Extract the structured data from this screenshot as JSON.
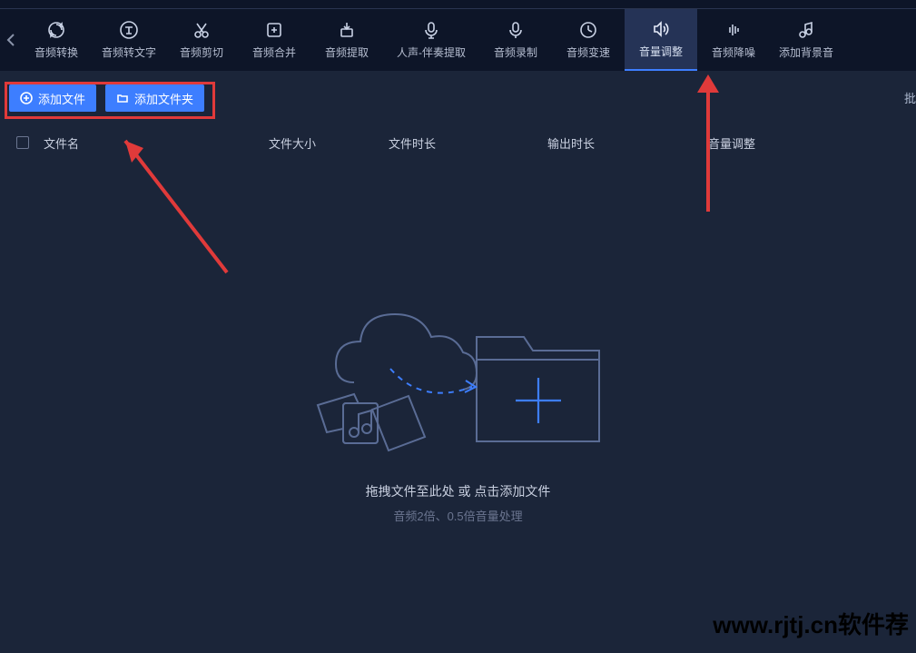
{
  "toolbar": {
    "items": [
      {
        "label": "音频转换",
        "icon": "refresh"
      },
      {
        "label": "音频转文字",
        "icon": "text"
      },
      {
        "label": "音频剪切",
        "icon": "scissors"
      },
      {
        "label": "音频合并",
        "icon": "merge"
      },
      {
        "label": "音频提取",
        "icon": "extract"
      },
      {
        "label": "人声-伴奏提取",
        "icon": "mic",
        "wide": true
      },
      {
        "label": "音频录制",
        "icon": "record"
      },
      {
        "label": "音频变速",
        "icon": "speed"
      },
      {
        "label": "音量调整",
        "icon": "volume",
        "active": true
      },
      {
        "label": "音频降噪",
        "icon": "denoise"
      },
      {
        "label": "添加背景音",
        "icon": "bgsound"
      }
    ]
  },
  "buttons": {
    "add_file": "添加文件",
    "add_folder": "添加文件夹"
  },
  "batch_label": "批",
  "table": {
    "col_name": "文件名",
    "col_size": "文件大小",
    "col_duration": "文件时长",
    "col_outduration": "输出时长",
    "col_volume": "音量调整"
  },
  "empty": {
    "main": "拖拽文件至此处 或 点击添加文件",
    "sub": "音频2倍、0.5倍音量处理"
  },
  "watermark": "www.rjtj.cn软件荐"
}
